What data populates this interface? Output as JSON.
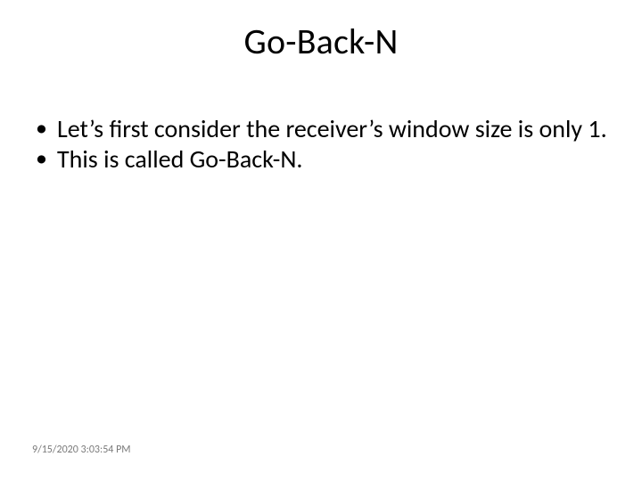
{
  "slide": {
    "title": "Go-Back-N",
    "bullets": [
      "Let’s first consider the receiver’s window size is only 1.",
      "This is called Go-Back-N."
    ],
    "footer_timestamp": "9/15/2020 3:03:54 PM"
  }
}
